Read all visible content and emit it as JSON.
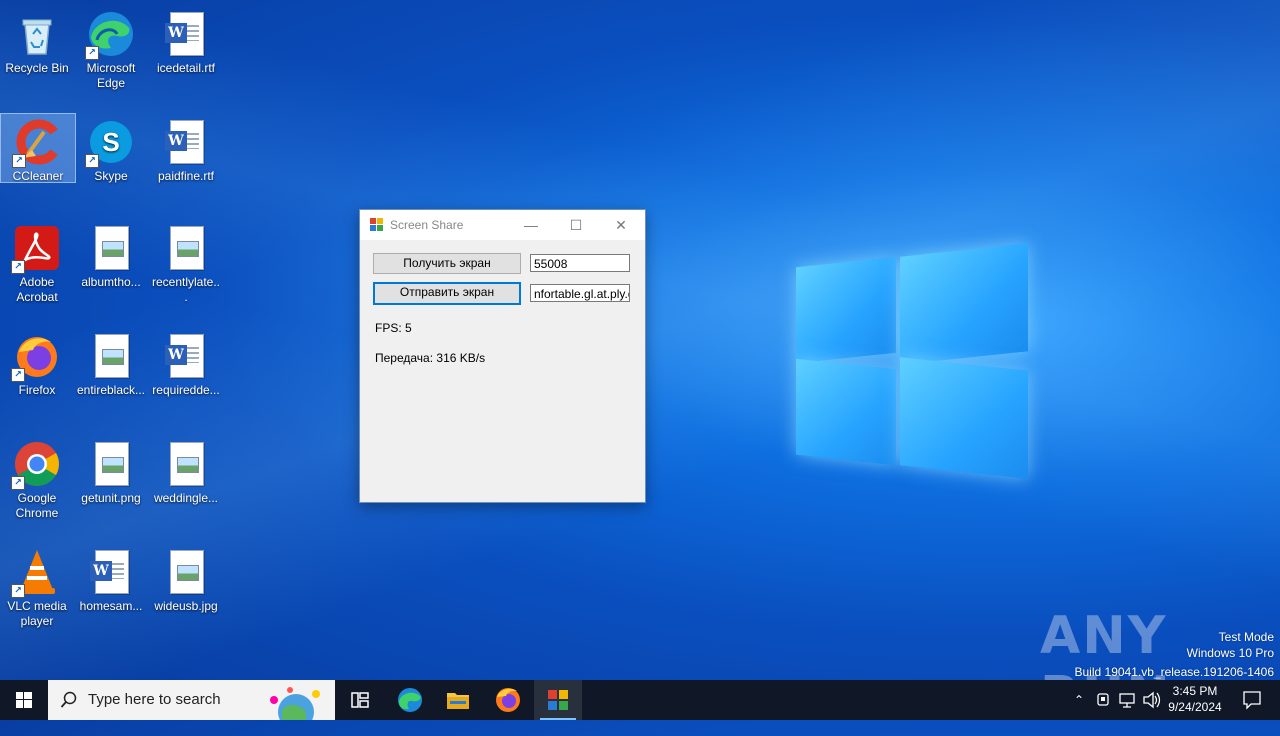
{
  "desktop": {
    "icons": [
      {
        "label": "Recycle Bin"
      },
      {
        "label": "Microsoft Edge"
      },
      {
        "label": "icedetail.rtf"
      },
      {
        "label": "CCleaner"
      },
      {
        "label": "Skype"
      },
      {
        "label": "paidfine.rtf"
      },
      {
        "label": "Adobe Acrobat"
      },
      {
        "label": "albumtho..."
      },
      {
        "label": "recentlylate..."
      },
      {
        "label": "Firefox"
      },
      {
        "label": "entireblack..."
      },
      {
        "label": "requiredde..."
      },
      {
        "label": "Google Chrome"
      },
      {
        "label": "getunit.png"
      },
      {
        "label": "weddingle..."
      },
      {
        "label": "VLC media player"
      },
      {
        "label": "homesam..."
      },
      {
        "label": "wideusb.jpg"
      }
    ]
  },
  "window": {
    "title": "Screen Share",
    "get_button": "Получить экран",
    "send_button": "Отправить экран",
    "port_value": "55008",
    "host_value": "nfortable.gl.at.ply.gg",
    "fps": "FPS: 5",
    "transfer": "Передача: 316 KB/s"
  },
  "watermark": {
    "brand": "ANY RUN",
    "line1": "Test Mode",
    "line2": "Windows 10 Pro",
    "line3": "Build 19041.vb_release.191206-1406"
  },
  "taskbar": {
    "search_placeholder": "Type here to search",
    "time": "3:45 PM",
    "date": "9/24/2024"
  },
  "colors": {
    "accent": "#0078d7",
    "taskbar": "#101828"
  }
}
